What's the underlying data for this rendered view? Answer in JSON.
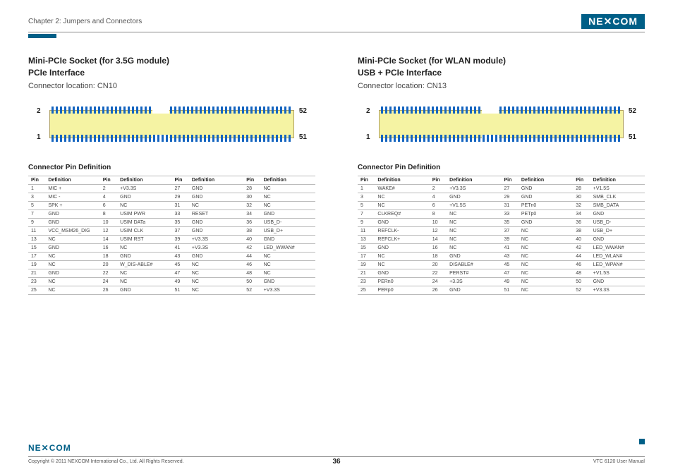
{
  "header": {
    "chapter": "Chapter 2: Jumpers and Connectors",
    "logo": "NE✕COM"
  },
  "left": {
    "title1": "Mini-PCIe Socket (for 3.5G module)",
    "title2": "PCIe Interface",
    "location": "Connector location: CN10",
    "diagram": {
      "pin_tl": "2",
      "pin_bl": "1",
      "pin_tr": "52",
      "pin_br": "51"
    },
    "table_title": "Connector Pin Definition",
    "headers": [
      "Pin",
      "Definition",
      "Pin",
      "Definition",
      "Pin",
      "Definition",
      "Pin",
      "Definition"
    ],
    "rows": [
      [
        "1",
        "MIC +",
        "2",
        "+V3.3S",
        "27",
        "GND",
        "28",
        "NC"
      ],
      [
        "3",
        "MIC -",
        "4",
        "GND",
        "29",
        "GND",
        "30",
        "NC"
      ],
      [
        "5",
        "SPK +",
        "6",
        "NC",
        "31",
        "NC",
        "32",
        "NC"
      ],
      [
        "7",
        "GND",
        "8",
        "USIM PWR",
        "33",
        "RESET",
        "34",
        "GND"
      ],
      [
        "9",
        "GND",
        "10",
        "USIM DATa",
        "35",
        "GND",
        "36",
        "USB_D-"
      ],
      [
        "11",
        "VCC_MSM26_DIG",
        "12",
        "USIM CLK",
        "37",
        "GND",
        "38",
        "USB_D+"
      ],
      [
        "13",
        "NC",
        "14",
        "USIM RST",
        "39",
        "+V3.3S",
        "40",
        "GND"
      ],
      [
        "15",
        "GND",
        "16",
        "NC",
        "41",
        "+V3.3S",
        "42",
        "LED_WWAN#"
      ],
      [
        "17",
        "NC",
        "18",
        "GND",
        "43",
        "GND",
        "44",
        "NC"
      ],
      [
        "19",
        "NC",
        "20",
        "W_DIS-ABLE#",
        "45",
        "NC",
        "46",
        "NC"
      ],
      [
        "21",
        "GND",
        "22",
        "NC",
        "47",
        "NC",
        "48",
        "NC"
      ],
      [
        "23",
        "NC",
        "24",
        "NC",
        "49",
        "NC",
        "50",
        "GND"
      ],
      [
        "25",
        "NC",
        "26",
        "GND",
        "51",
        "NC",
        "52",
        "+V3.3S"
      ]
    ]
  },
  "right": {
    "title1": "Mini-PCIe Socket (for WLAN module)",
    "title2": "USB + PCIe Interface",
    "location": "Connector location: CN13",
    "diagram": {
      "pin_tl": "2",
      "pin_bl": "1",
      "pin_tr": "52",
      "pin_br": "51"
    },
    "table_title": "Connector Pin Definition",
    "headers": [
      "Pin",
      "Definition",
      "Pin",
      "Definition",
      "Pin",
      "Definition",
      "Pin",
      "Definition"
    ],
    "rows": [
      [
        "1",
        "WAKE#",
        "2",
        "+V3.3S",
        "27",
        "GND",
        "28",
        "+V1.5S"
      ],
      [
        "3",
        "NC",
        "4",
        "GND",
        "29",
        "GND",
        "30",
        "SMB_CLK"
      ],
      [
        "5",
        "NC",
        "6",
        "+V1.5S",
        "31",
        "PETn0",
        "32",
        "SMB_DATA"
      ],
      [
        "7",
        "CLKREQ#",
        "8",
        "NC",
        "33",
        "PETp0",
        "34",
        "GND"
      ],
      [
        "9",
        "GND",
        "10",
        "NC",
        "35",
        "GND",
        "36",
        "USB_D-"
      ],
      [
        "11",
        "REFCLK-",
        "12",
        "NC",
        "37",
        "NC",
        "38",
        "USB_D+"
      ],
      [
        "13",
        "REFCLK+",
        "14",
        "NC",
        "39",
        "NC",
        "40",
        "GND"
      ],
      [
        "15",
        "GND",
        "16",
        "NC",
        "41",
        "NC",
        "42",
        "LED_WWAN#"
      ],
      [
        "17",
        "NC",
        "18",
        "GND",
        "43",
        "NC",
        "44",
        "LED_WLAN#"
      ],
      [
        "19",
        "NC",
        "20",
        "DISABLE#",
        "45",
        "NC",
        "46",
        "LED_WPAN#"
      ],
      [
        "21",
        "GND",
        "22",
        "PERST#",
        "47",
        "NC",
        "48",
        "+V1.5S"
      ],
      [
        "23",
        "PERn0",
        "24",
        "+3.3S",
        "49",
        "NC",
        "50",
        "GND"
      ],
      [
        "25",
        "PERp0",
        "26",
        "GND",
        "51",
        "NC",
        "52",
        "+V3.3S"
      ]
    ]
  },
  "footer": {
    "logo": "NE✕COM",
    "copyright": "Copyright © 2011 NEXCOM International Co., Ltd. All Rights Reserved.",
    "page": "36",
    "manual": "VTC 6120 User Manual"
  }
}
